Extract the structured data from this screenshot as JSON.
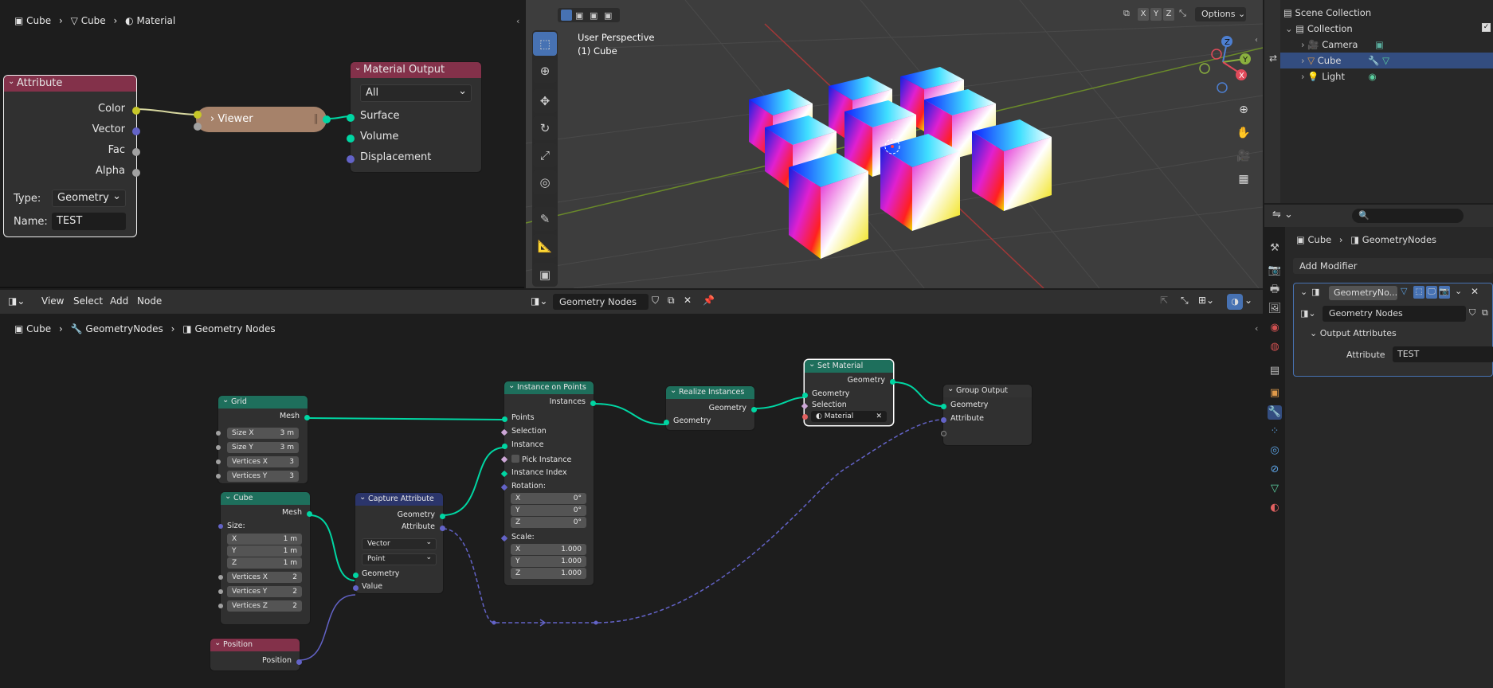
{
  "shader_editor": {
    "breadcrumb": [
      "Cube",
      "Cube",
      "Material"
    ],
    "attribute_node": {
      "title": "Attribute",
      "outputs": [
        "Color",
        "Vector",
        "Fac",
        "Alpha"
      ],
      "type_label": "Type:",
      "type_value": "Geometry",
      "name_label": "Name:",
      "name_value": "TEST"
    },
    "viewer_node": {
      "title": "Viewer"
    },
    "material_output_node": {
      "title": "Material Output",
      "target": "All",
      "inputs": [
        "Surface",
        "Volume",
        "Displacement"
      ]
    }
  },
  "viewport": {
    "perspective_label": "User Perspective",
    "object_label": "(1) Cube",
    "axis_buttons": [
      "X",
      "Y",
      "Z"
    ],
    "options_label": "Options",
    "gizmo_axes": [
      "Z",
      "Y",
      "X"
    ]
  },
  "outliner": {
    "items": [
      {
        "label": "Scene Collection",
        "indent": 0
      },
      {
        "label": "Collection",
        "indent": 1
      },
      {
        "label": "Camera",
        "indent": 2
      },
      {
        "label": "Cube",
        "indent": 2,
        "selected": true
      },
      {
        "label": "Light",
        "indent": 2
      }
    ]
  },
  "properties": {
    "breadcrumb": [
      "Cube",
      "GeometryNodes"
    ],
    "add_modifier": "Add Modifier",
    "modifier_name": "GeometryNo...",
    "node_group": "Geometry Nodes",
    "panel_title": "Output Attributes",
    "attribute_label": "Attribute",
    "attribute_value": "TEST"
  },
  "geo_editor": {
    "menus": [
      "View",
      "Select",
      "Add",
      "Node"
    ],
    "node_group_name": "Geometry Nodes",
    "breadcrumb": [
      "Cube",
      "GeometryNodes",
      "Geometry Nodes"
    ],
    "nodes": {
      "grid": {
        "title": "Grid",
        "output": "Mesh",
        "fields": [
          [
            "Size X",
            "3 m"
          ],
          [
            "Size Y",
            "3 m"
          ],
          [
            "Vertices X",
            "3"
          ],
          [
            "Vertices Y",
            "3"
          ]
        ]
      },
      "cube": {
        "title": "Cube",
        "output": "Mesh",
        "size_label": "Size:",
        "size_fields": [
          [
            "X",
            "1 m"
          ],
          [
            "Y",
            "1 m"
          ],
          [
            "Z",
            "1 m"
          ]
        ],
        "vert_fields": [
          [
            "Vertices X",
            "2"
          ],
          [
            "Vertices Y",
            "2"
          ],
          [
            "Vertices Z",
            "2"
          ]
        ]
      },
      "position": {
        "title": "Position",
        "output": "Position"
      },
      "capture": {
        "title": "Capture Attribute",
        "outputs": [
          "Geometry",
          "Attribute"
        ],
        "data_type": "Vector",
        "domain": "Point",
        "inputs": [
          "Geometry",
          "Value"
        ]
      },
      "instance": {
        "title": "Instance on Points",
        "output": "Instances",
        "inputs": [
          "Points",
          "Selection",
          "Instance",
          "Pick Instance",
          "Instance Index",
          "Rotation:"
        ],
        "rotation": [
          [
            "X",
            "0°"
          ],
          [
            "Y",
            "0°"
          ],
          [
            "Z",
            "0°"
          ]
        ],
        "scale_label": "Scale:",
        "scale": [
          [
            "X",
            "1.000"
          ],
          [
            "Y",
            "1.000"
          ],
          [
            "Z",
            "1.000"
          ]
        ]
      },
      "realize": {
        "title": "Realize Instances",
        "output": "Geometry",
        "input": "Geometry"
      },
      "set_material": {
        "title": "Set Material",
        "output": "Geometry",
        "inputs": [
          "Geometry",
          "Selection"
        ],
        "material": "Material"
      },
      "group_output": {
        "title": "Group Output",
        "inputs": [
          "Geometry",
          "Attribute"
        ]
      }
    }
  },
  "colors": {
    "geometry_socket": "#00d6a3",
    "vector_socket": "#6363c7",
    "attribute_header": "#83314a",
    "geometry_header": "#1e6f5c",
    "converter_header": "#2b356b",
    "selection": "#334d80"
  }
}
